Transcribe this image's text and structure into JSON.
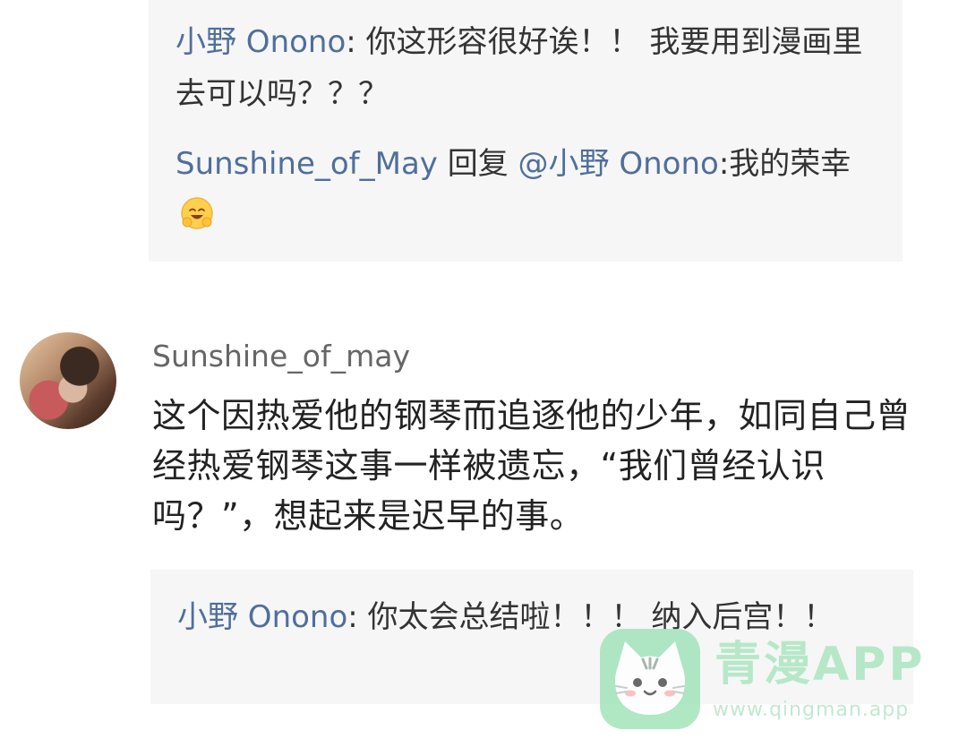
{
  "top_replies": [
    {
      "name": "小野 Onono",
      "sep": ": ",
      "text": "你这形容很好诶！！ 我要用到漫画里去可以吗？？？"
    },
    {
      "name": "Sunshine_of_May",
      "reply_word": " 回复 ",
      "mention": "@小野 Onono",
      "sep": ":",
      "text": "我的荣幸",
      "emoji": "hugging-face-emoji"
    }
  ],
  "comment": {
    "author": "Sunshine_of_may",
    "body": "这个因热爱他的钢琴而追逐他的少年，如同自己曾经热爱钢琴这事一样被遗忘，“我们曾经认识吗？”，想起来是迟早的事。"
  },
  "bottom_replies": [
    {
      "name": "小野 Onono",
      "sep": ": ",
      "text": "你太会总结啦！！！ 纳入后宫！！"
    }
  ],
  "watermark": {
    "title": "青漫APP",
    "url": "www.qingman.app",
    "icon": "cat-logo-icon"
  },
  "colors": {
    "username": "#4f6f9c",
    "reply_bg": "#f6f6f6",
    "text": "#222222",
    "watermark": "#b6e8c8"
  }
}
